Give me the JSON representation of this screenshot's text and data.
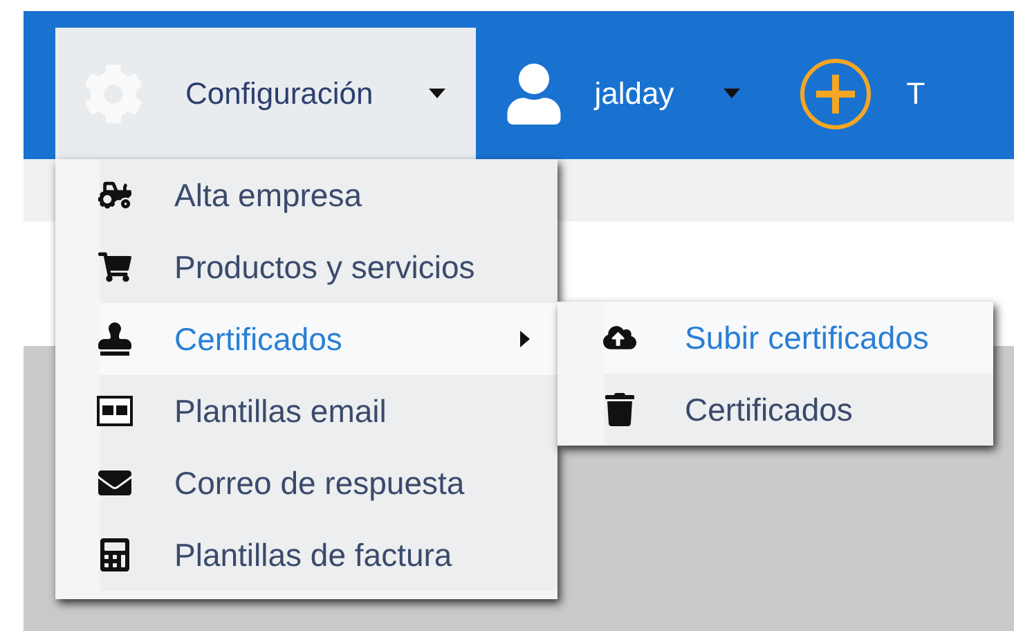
{
  "nav": [
    {
      "kind": "settings",
      "label": "Configuración",
      "expanded": true
    },
    {
      "kind": "user",
      "label": "jalday",
      "expanded": false
    },
    {
      "kind": "add",
      "label": "T"
    }
  ],
  "menu": [
    {
      "kind": "tractor",
      "label": "Alta empresa",
      "selected": false,
      "submenu": false
    },
    {
      "kind": "cart",
      "label": "Productos y servicios",
      "selected": false,
      "submenu": false
    },
    {
      "kind": "stamp",
      "label": "Certificados",
      "selected": true,
      "submenu": true
    },
    {
      "kind": "template",
      "label": "Plantillas email",
      "selected": false,
      "submenu": false
    },
    {
      "kind": "envelope",
      "label": "Correo de respuesta",
      "selected": false,
      "submenu": false
    },
    {
      "kind": "invoice",
      "label": "Plantillas de factura",
      "selected": false,
      "submenu": false
    }
  ],
  "submenu": [
    {
      "kind": "upload",
      "label": "Subir certificados",
      "selected": true
    },
    {
      "kind": "trash",
      "label": "Certificados",
      "selected": false
    }
  ]
}
